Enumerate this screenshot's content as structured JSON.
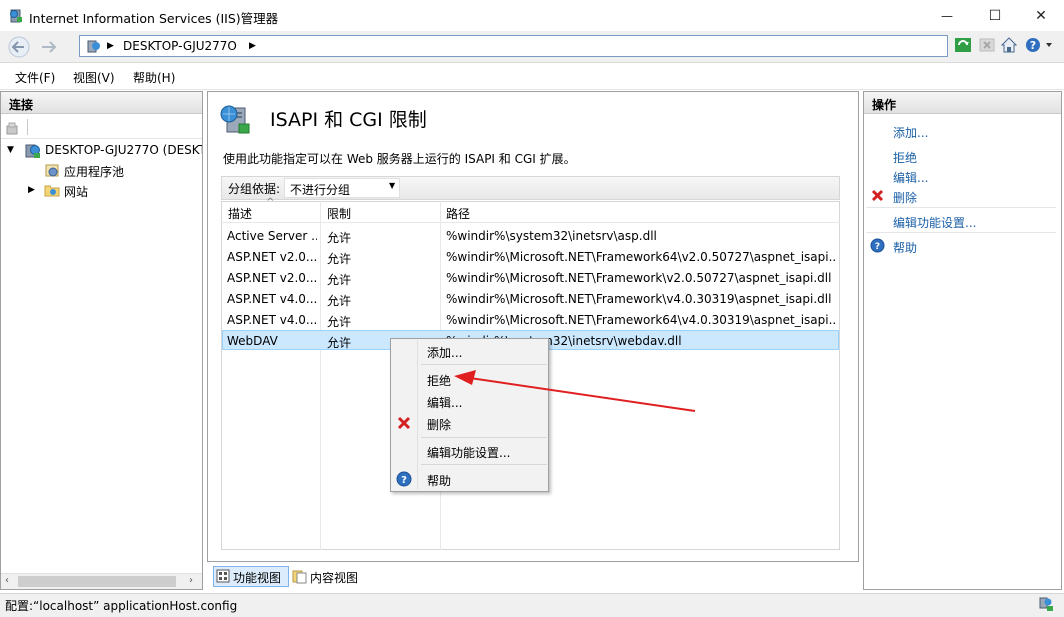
{
  "window": {
    "title": "Internet Information Services (IIS)管理器",
    "controls": {
      "minimize": "—",
      "maximize": "☐",
      "close": "✕"
    }
  },
  "address": {
    "path": "DESKTOP-GJU277O"
  },
  "menu": [
    "文件(F)",
    "视图(V)",
    "帮助(H)"
  ],
  "connections": {
    "header": "连接",
    "tree": [
      {
        "label": "DESKTOP-GJU277O (DESKT",
        "icon": "server-icon"
      },
      {
        "label": "应用程序池",
        "icon": "app-pool-icon"
      },
      {
        "label": "网站",
        "icon": "sites-folder-icon"
      }
    ]
  },
  "feature": {
    "title": "ISAPI 和 CGI 限制",
    "description": "使用此功能指定可以在 Web 服务器上运行的 ISAPI 和 CGI 扩展。",
    "group_label": "分组依据:",
    "group_value": "不进行分组",
    "columns": [
      "描述",
      "限制",
      "路径"
    ],
    "rows": [
      {
        "desc": "Active Server ...",
        "restriction": "允许",
        "path": "%windir%\\system32\\inetsrv\\asp.dll"
      },
      {
        "desc": "ASP.NET v2.0....",
        "restriction": "允许",
        "path": "%windir%\\Microsoft.NET\\Framework64\\v2.0.50727\\aspnet_isapi...."
      },
      {
        "desc": "ASP.NET v2.0....",
        "restriction": "允许",
        "path": "%windir%\\Microsoft.NET\\Framework\\v2.0.50727\\aspnet_isapi.dll"
      },
      {
        "desc": "ASP.NET v4.0....",
        "restriction": "允许",
        "path": "%windir%\\Microsoft.NET\\Framework\\v4.0.30319\\aspnet_isapi.dll"
      },
      {
        "desc": "ASP.NET v4.0....",
        "restriction": "允许",
        "path": "%windir%\\Microsoft.NET\\Framework64\\v4.0.30319\\aspnet_isapi...."
      },
      {
        "desc": "WebDAV",
        "restriction": "允许",
        "path": "%windir%\\system32\\inetsrv\\webdav.dll"
      }
    ],
    "tabs": [
      "功能视图",
      "内容视图"
    ]
  },
  "context_menu": {
    "items": [
      "添加...",
      "拒绝",
      "编辑...",
      "删除",
      "编辑功能设置...",
      "帮助"
    ]
  },
  "actions": {
    "header": "操作",
    "items": [
      "添加...",
      "拒绝",
      "编辑...",
      "删除",
      "编辑功能设置...",
      "帮助"
    ]
  },
  "status": {
    "text": "配置:“localhost” applicationHost.config"
  },
  "colors": {
    "link": "#1a5fa6",
    "selection": "#cce8ff",
    "arrow": "#e02020",
    "delete": "#d32020"
  }
}
